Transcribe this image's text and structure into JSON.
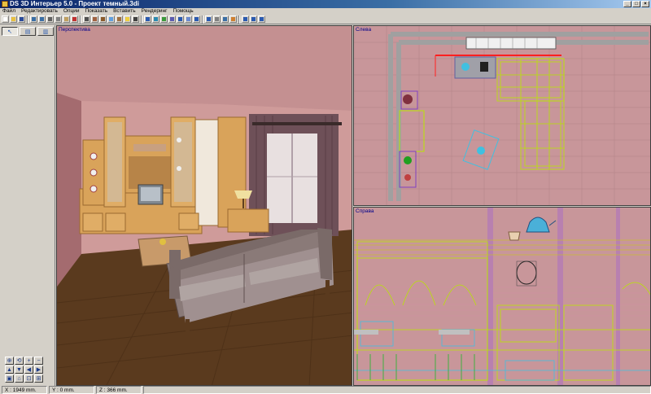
{
  "window": {
    "title": "DS 3D Интерьер 5.0 - Проект темный.3di"
  },
  "menu": {
    "items": [
      "Файл",
      "Редактировать",
      "Опции",
      "Показать",
      "Вставить",
      "Рендеринг",
      "Помощь"
    ]
  },
  "toolbar": {
    "buttons": [
      "new-icon",
      "open-icon",
      "save-icon",
      "undo-icon",
      "redo-icon",
      "cut-icon",
      "copy-icon",
      "paste-icon",
      "delete-icon",
      "print-icon",
      "wall-icon",
      "door-icon",
      "window-icon",
      "floor-icon",
      "light-icon",
      "camera-icon",
      "move-icon",
      "rotate-icon",
      "scale-icon",
      "mirror-icon",
      "group-icon",
      "ungroup-icon",
      "align-icon",
      "snap-icon",
      "grid-icon",
      "zoom-icon",
      "render-icon",
      "view-1-icon",
      "view-2-icon",
      "view-4-icon"
    ]
  },
  "viewports": {
    "perspective": {
      "label": "Перспектива"
    },
    "left": {
      "label": "Слева"
    },
    "right": {
      "label": "Справа"
    }
  },
  "statusbar": {
    "x": "X : 1949 mm.",
    "y": "Y : 0 mm.",
    "z": "Z : 366 mm."
  },
  "colors": {
    "wall": "#c89494",
    "floor": "#5a3a1e",
    "furniture": "#d9a35a",
    "wireframe": "#b8e600",
    "selection": "#ff2020"
  }
}
